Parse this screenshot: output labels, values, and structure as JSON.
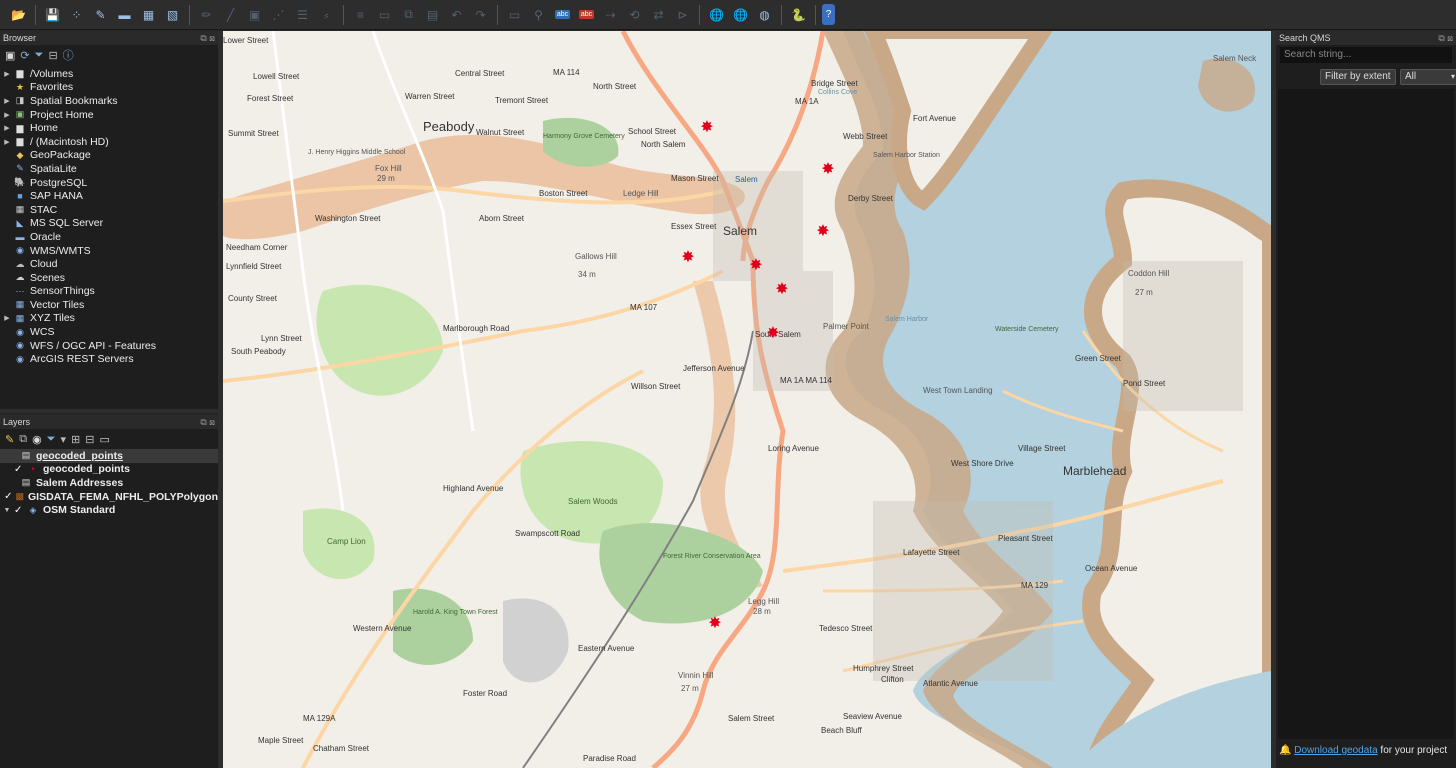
{
  "toolbar": {
    "icons": [
      "open-project-icon",
      "save-project-icon",
      "new-layer-icon",
      "digitize-icon",
      "layer-icon",
      "grid-icon",
      "style-icon",
      "pencil-icon",
      "pen-icon",
      "save-edits-icon",
      "node-icon",
      "table-icon",
      "snap-icon",
      "attribute-icon",
      "delete-icon",
      "copy-icon",
      "paste-icon",
      "undo-icon",
      "redo-icon",
      "label-icon",
      "pin-icon",
      "abc-label-icon",
      "abc-red-icon",
      "label-move-icon",
      "label-rotate-icon",
      "label-change-icon",
      "label-show-icon",
      "globe-add-icon",
      "globe-grid-icon",
      "qms-icon",
      "python-icon",
      "help-icon"
    ],
    "abc_label": "abc"
  },
  "browser": {
    "title": "Browser",
    "items": [
      {
        "label": "/Volumes",
        "icon": "folder-icon",
        "expandable": true
      },
      {
        "label": "Favorites",
        "icon": "star-icon",
        "expandable": false
      },
      {
        "label": "Spatial Bookmarks",
        "icon": "bookmark-icon",
        "expandable": true
      },
      {
        "label": "Project Home",
        "icon": "project-home-icon",
        "expandable": true
      },
      {
        "label": "Home",
        "icon": "folder-icon",
        "expandable": true
      },
      {
        "label": "/ (Macintosh HD)",
        "icon": "folder-icon",
        "expandable": true
      },
      {
        "label": "GeoPackage",
        "icon": "geopackage-icon",
        "expandable": false
      },
      {
        "label": "SpatiaLite",
        "icon": "spatialite-icon",
        "expandable": false
      },
      {
        "label": "PostgreSQL",
        "icon": "postgresql-icon",
        "expandable": false
      },
      {
        "label": "SAP HANA",
        "icon": "sap-hana-icon",
        "expandable": false
      },
      {
        "label": "STAC",
        "icon": "stac-icon",
        "expandable": false
      },
      {
        "label": "MS SQL Server",
        "icon": "mssql-icon",
        "expandable": false
      },
      {
        "label": "Oracle",
        "icon": "oracle-icon",
        "expandable": false
      },
      {
        "label": "WMS/WMTS",
        "icon": "wms-icon",
        "expandable": false
      },
      {
        "label": "Cloud",
        "icon": "cloud-icon",
        "expandable": false
      },
      {
        "label": "Scenes",
        "icon": "scenes-icon",
        "expandable": false
      },
      {
        "label": "SensorThings",
        "icon": "sensorthings-icon",
        "expandable": false
      },
      {
        "label": "Vector Tiles",
        "icon": "vector-tiles-icon",
        "expandable": false
      },
      {
        "label": "XYZ Tiles",
        "icon": "xyz-tiles-icon",
        "expandable": true
      },
      {
        "label": "WCS",
        "icon": "wcs-icon",
        "expandable": false
      },
      {
        "label": "WFS / OGC API - Features",
        "icon": "wfs-icon",
        "expandable": false
      },
      {
        "label": "ArcGIS REST Servers",
        "icon": "arcgis-icon",
        "expandable": false
      }
    ]
  },
  "layers": {
    "title": "Layers",
    "items": [
      {
        "label": "geocoded_points",
        "icon": "table-icon",
        "checked": null,
        "underline": true,
        "selected": true
      },
      {
        "label": "geocoded_points",
        "icon": "point-icon",
        "checked": true,
        "underline": false,
        "selected": false
      },
      {
        "label": "Salem Addresses",
        "icon": "table-icon",
        "checked": null,
        "underline": false,
        "selected": false
      },
      {
        "label": "GISDATA_FEMA_NFHL_POLYPolygon",
        "icon": "polygon-icon",
        "checked": true,
        "underline": false,
        "selected": false
      },
      {
        "label": "OSM Standard",
        "icon": "osm-icon",
        "checked": true,
        "underline": false,
        "selected": false
      }
    ]
  },
  "map": {
    "places": [
      "Peabody",
      "Salem",
      "Marblehead",
      "Salem Neck",
      "Gallows Hill",
      "34 m",
      "Fox Hill",
      "29 m",
      "Ledge Hill",
      "Coddon Hill",
      "27 m",
      "Legg Hill",
      "28 m",
      "Vinnin Hill",
      "27 m",
      "South Peabody",
      "Needham Corner",
      "South Salem",
      "Palmer Point",
      "Salem Harbor",
      "West Town Landing",
      "Salem Woods",
      "Camp Lion",
      "Clifton",
      "Beach Bluff",
      "North Salem",
      "Harmony Grove Cemetery",
      "Waterside Cemetery",
      "Forest River Conservation Area",
      "Harold A. King Town Forest",
      "J. Henry Higgins Middle School",
      "Collins Cove",
      "Salem Harbor Station",
      "Salem"
    ],
    "roads": [
      "MA 114",
      "MA 1A",
      "MA 107",
      "MA 129",
      "MA 129A",
      "MA 1A MA 114",
      "Lowell Street",
      "Forest Street",
      "Warren Street",
      "Tremont Street",
      "Central Street",
      "Walnut Street",
      "Boston Street",
      "Aborn Street",
      "Washington Street",
      "Lynnfield Street",
      "Essex Street",
      "Mason Street",
      "School Street",
      "North Street",
      "Bridge Street",
      "Webb Street",
      "Derby Street",
      "Fort Avenue",
      "Highland Avenue",
      "Willson Street",
      "Jefferson Avenue",
      "Loring Avenue",
      "Lafayette Street",
      "Pleasant Street",
      "Ocean Avenue",
      "Atlantic Avenue",
      "Village Street",
      "West Shore Drive",
      "Green Street",
      "Pond Street",
      "Tedesco Street",
      "Humphrey Street",
      "Seaview Avenue",
      "Paradise Road",
      "Western Avenue",
      "Swampscott Road",
      "Foster Road",
      "Maple Street",
      "Chatham Street",
      "Summit Street",
      "County Street",
      "Lynn Street",
      "Salem Street",
      "Eastern Avenue",
      "Marlborough Road",
      "Lower Street"
    ],
    "markers": 9
  },
  "qms": {
    "title": "Search QMS",
    "placeholder": "Search string...",
    "filter_label": "Filter by extent",
    "filter_value": "All",
    "download_link": "Download geodata",
    "download_rest": " for your project"
  },
  "colors": {
    "water": "#b3d1de",
    "land": "#f2efe9",
    "flood": "#e8b489",
    "park": "#c8e6b0",
    "road_primary": "#fcd6a4",
    "road_trunk": "#f7a882",
    "marker": "#e0001b"
  }
}
